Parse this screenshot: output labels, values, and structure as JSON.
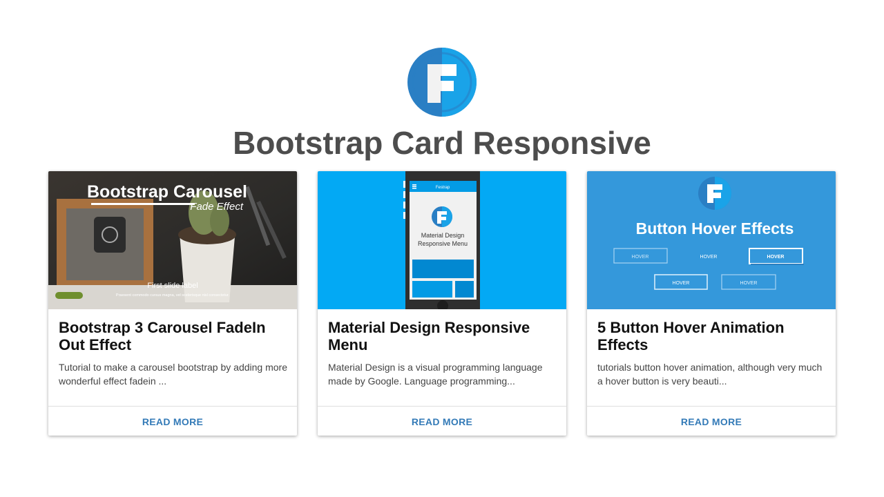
{
  "page": {
    "title": "Bootstrap Card Responsive",
    "logo_letter": "F"
  },
  "colors": {
    "logo_blue": "#2a7fc4",
    "logo_cyan": "#1aa3e8",
    "link": "#337ab7",
    "title": "#4d4d4d"
  },
  "cards": [
    {
      "image": {
        "heading": "Bootstrap Carousel",
        "subheading": "Fade Effect",
        "caption": "First slide label",
        "caption_text": "Praesent commodo cursus magna, vel scelerisque nisl consectetur."
      },
      "title": "Bootstrap 3 Carousel FadeIn Out Effect",
      "text": "Tutorial to make a carousel bootstrap by adding more wonderful effect fadein ...",
      "action": "READ MORE"
    },
    {
      "image": {
        "appbar_title": "Festrap",
        "logo_letter": "F",
        "screen_text_line1": "Material Design",
        "screen_text_line2": "Responsive Menu"
      },
      "title": "Material Design Responsive Menu",
      "text": "Material Design is a visual programming language made by Google. Language programming...",
      "action": "READ MORE"
    },
    {
      "image": {
        "logo_letter": "F",
        "heading": "Button Hover Effects",
        "buttons": [
          "HOVER",
          "HOVER",
          "HOVER",
          "HOVER",
          "HOVER"
        ]
      },
      "title": "5 Button Hover Animation Effects",
      "text": "tutorials button hover animation, although very much a hover button is very beauti...",
      "action": "READ MORE"
    }
  ]
}
